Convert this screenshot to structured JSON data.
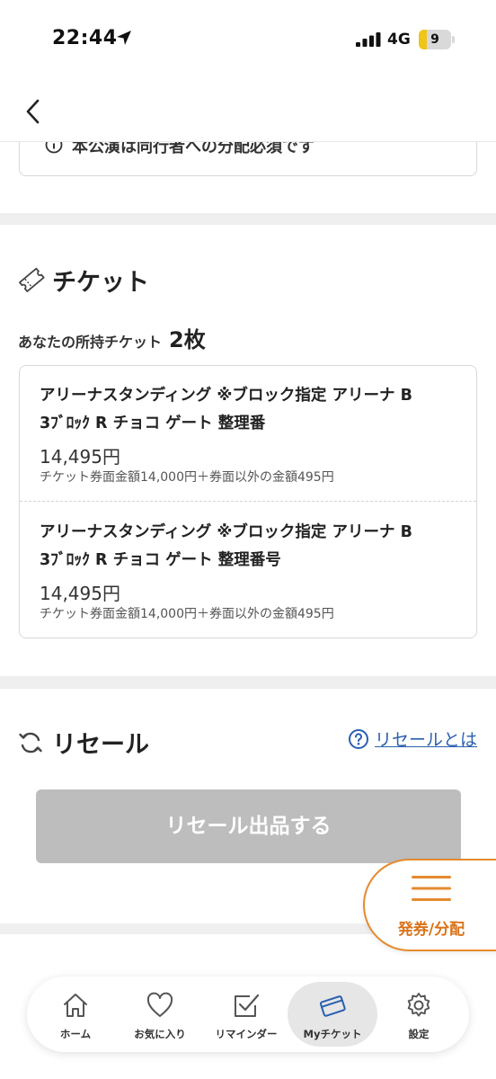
{
  "status": {
    "time": "22:44",
    "network": "4G",
    "battery": "9"
  },
  "notice": {
    "text": "本公演は同行者への分配必須です"
  },
  "ticket_section": {
    "title": "チケット",
    "owned_label": "あなたの所持チケット",
    "owned_count": "2枚",
    "tickets": [
      {
        "name_line1": "アリーナスタンディング ※ブロック指定 アリーナ B",
        "name_line2": "3ﾌﾞﾛｯｸ R チョコ ゲート 整理番",
        "price": "14,495円",
        "breakdown": "チケット券面金額14,000円＋券面以外の金額495円"
      },
      {
        "name_line1": "アリーナスタンディング ※ブロック指定 アリーナ B",
        "name_line2": "3ﾌﾞﾛｯｸ R チョコ ゲート 整理番号",
        "price": "14,495円",
        "breakdown": "チケット券面金額14,000円＋券面以外の金額495円"
      }
    ]
  },
  "resale_section": {
    "title": "リセール",
    "help_link": "リセールとは",
    "button": "リセール出品する"
  },
  "fab": {
    "label": "発券/分配",
    "color": "#e58a2e"
  },
  "tab_bar": {
    "tabs": [
      {
        "label": "ホーム",
        "icon": "home-icon"
      },
      {
        "label": "お気に入り",
        "icon": "heart-icon"
      },
      {
        "label": "リマインダー",
        "icon": "checkbox-icon"
      },
      {
        "label": "Myチケット",
        "icon": "ticket-icon",
        "active": true
      },
      {
        "label": "設定",
        "icon": "gear-icon"
      }
    ]
  }
}
